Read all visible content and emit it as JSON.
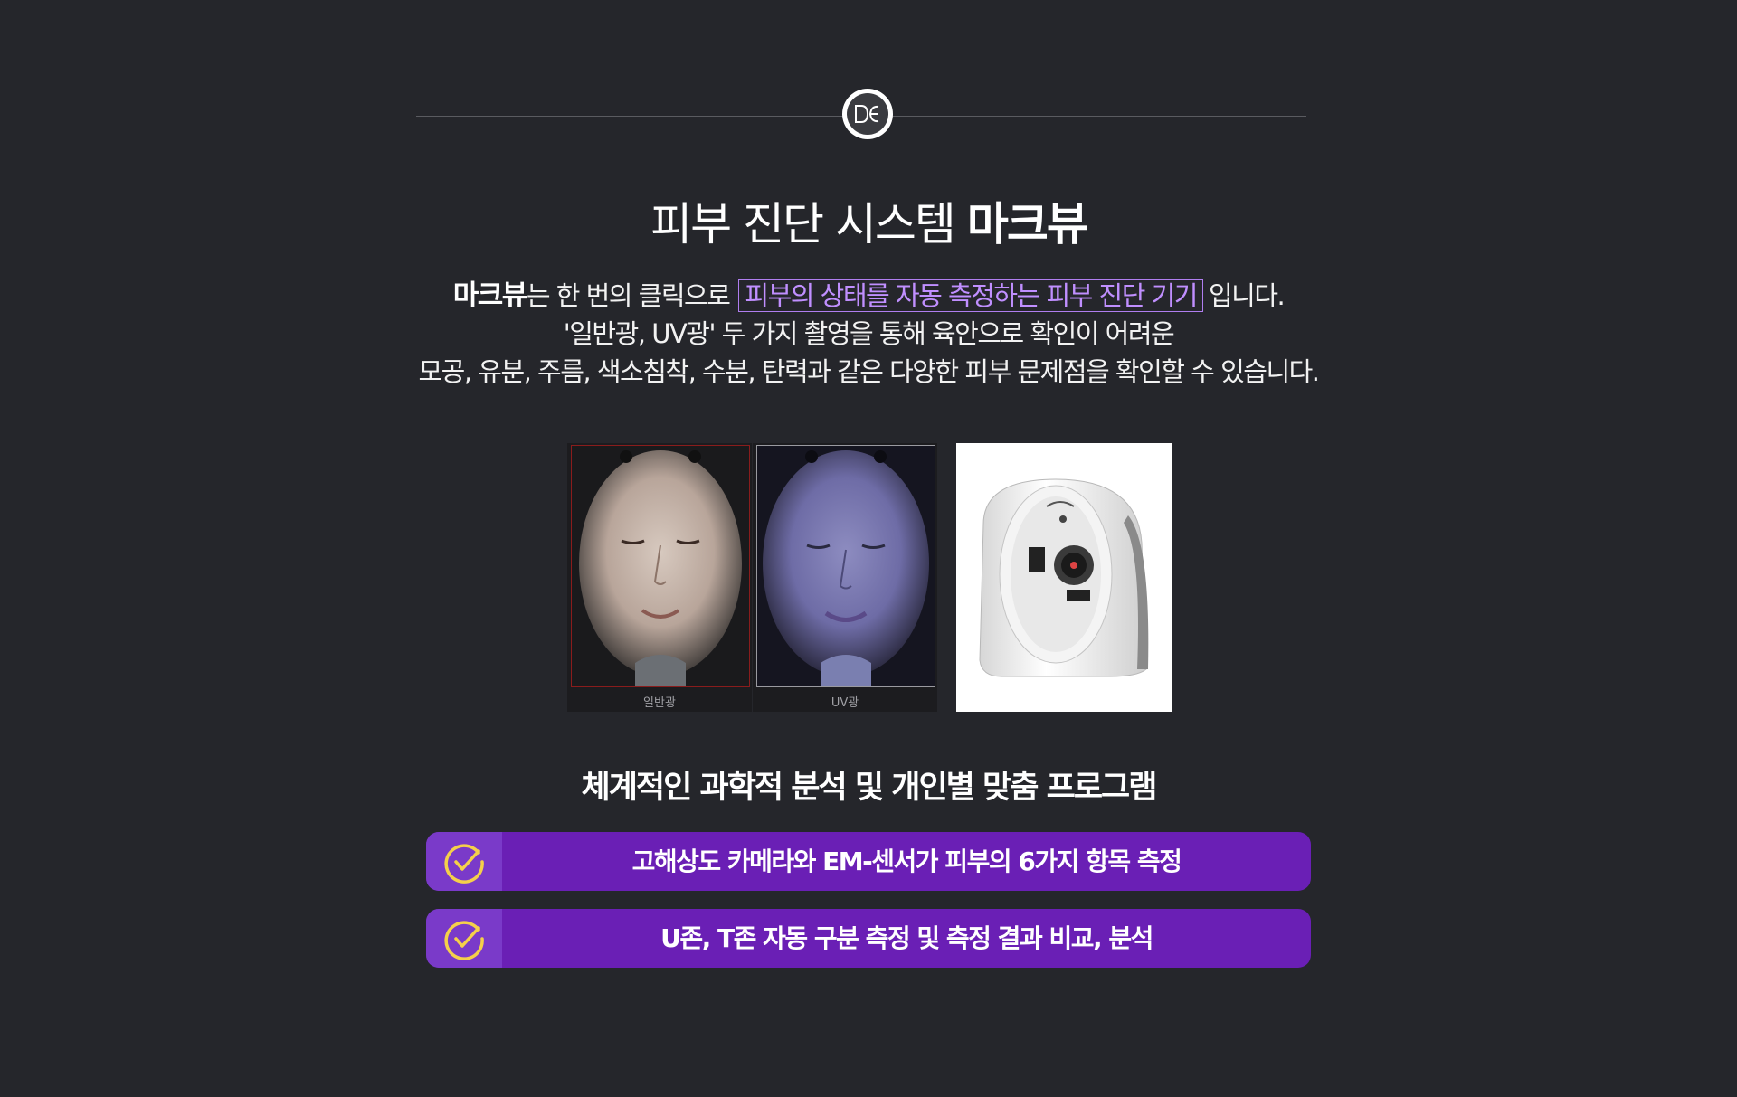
{
  "header": {
    "logo_icon": "de-monogram-icon"
  },
  "title": {
    "prefix": "피부 진단 시스템",
    "brand": "마크뷰"
  },
  "description": {
    "line1_brand": "마크뷰",
    "line1_text_a": "는  한 번의 클릭으로",
    "line1_highlight": "피부의 상태를 자동 측정하는 피부 진단 기기",
    "line1_text_b": "입니다.",
    "line2": "'일반광, UV광' 두 가지 촬영을 통해 육안으로 확인이 어려운",
    "line3": "모공, 유분, 주름, 색소침착, 수분, 탄력과 같은 다양한 피부 문제점을 확인할 수 있습니다."
  },
  "photos": [
    {
      "label": "일반광"
    },
    {
      "label": "UV광"
    }
  ],
  "section_title": "체계적인 과학적 분석 및 개인별 맞춤 프로그램",
  "features": [
    {
      "icon": "check-circle-icon",
      "text": "고해상도 카메라와 EM-센서가 피부의 6가지 항목 측정"
    },
    {
      "icon": "check-circle-icon",
      "text": "U존, T존 자동 구분 측정 및 측정 결과 비교, 분석"
    }
  ],
  "colors": {
    "background": "#25262b",
    "accent_purple": "#6a1fb5",
    "highlight_text": "#c08fff",
    "check_yellow": "#f5d04a"
  }
}
